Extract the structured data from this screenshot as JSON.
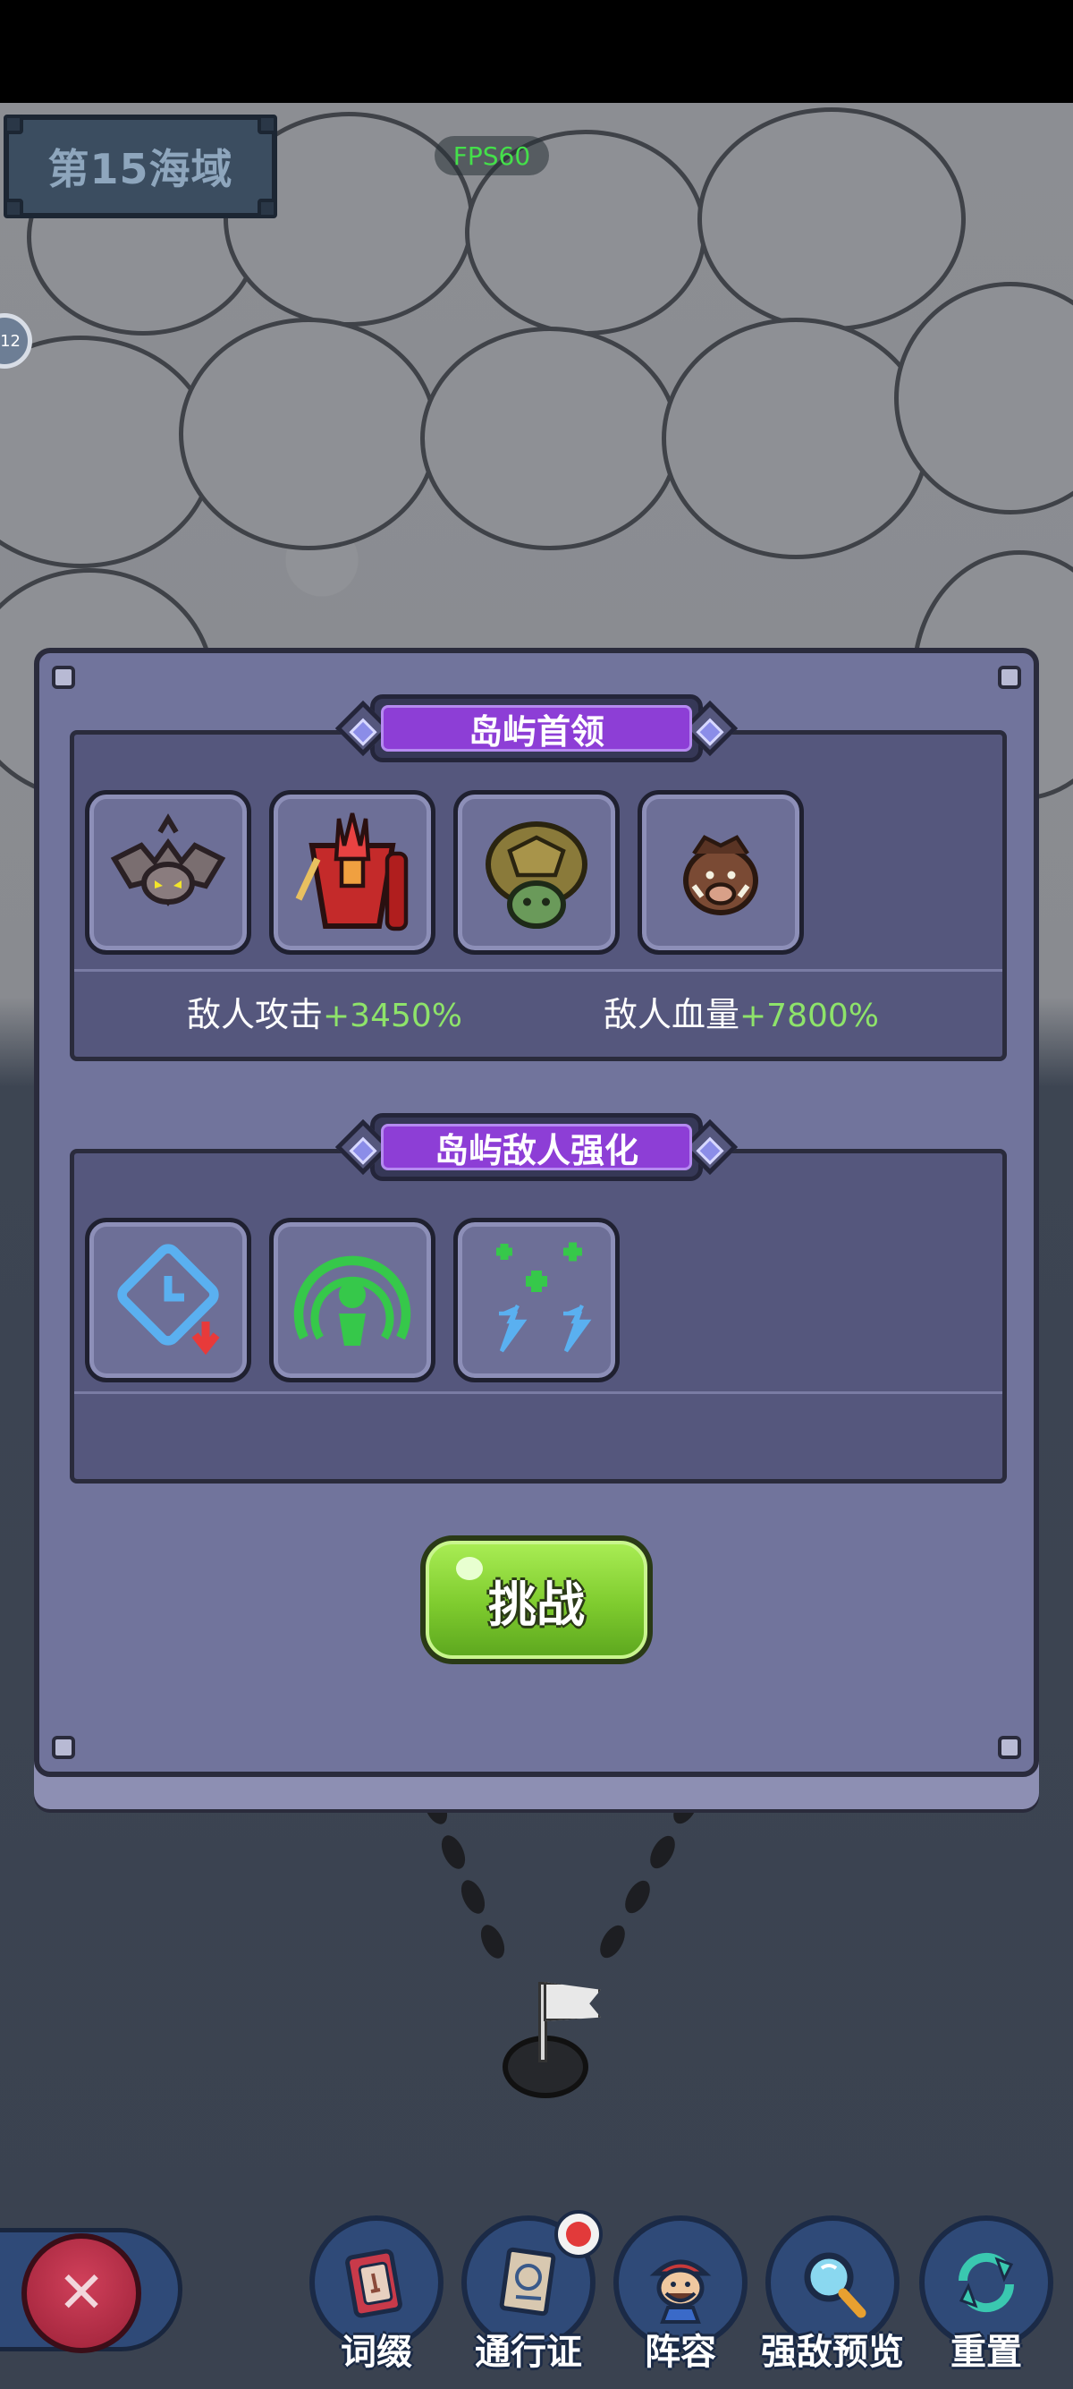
{
  "hud": {
    "sea_zone": "第15海域",
    "fps": "FPS60",
    "side_badge": "12"
  },
  "modal": {
    "boss_section": {
      "title": "岛屿首领",
      "bosses": [
        {
          "icon": "bat-boss-icon"
        },
        {
          "icon": "red-armored-warrior-icon"
        },
        {
          "icon": "turtle-boss-icon"
        },
        {
          "icon": "boar-boss-icon"
        }
      ],
      "attack_label": "敌人攻击",
      "attack_value": "+3450%",
      "hp_label": "敌人血量",
      "hp_value": "+7800%"
    },
    "buff_section": {
      "title": "岛屿敌人强化",
      "buffs": [
        {
          "icon": "clock-cooldown-down-icon"
        },
        {
          "icon": "shield-aura-icon"
        },
        {
          "icon": "energy-boost-plus-icon"
        }
      ]
    },
    "challenge_label": "挑战"
  },
  "bottom_nav": {
    "close_icon": "close-icon",
    "items": [
      {
        "label": "词缀",
        "icon": "affix-card-icon"
      },
      {
        "label": "通行证",
        "icon": "passport-icon"
      },
      {
        "label": "阵容",
        "icon": "lineup-pirate-icon"
      },
      {
        "label": "强敌预览",
        "icon": "magnifier-icon"
      },
      {
        "label": "重置",
        "icon": "reset-arrows-icon"
      }
    ]
  },
  "colors": {
    "modal_bg": "#71749c",
    "section_bg": "#55577d",
    "banner_purple": "#8d3ed6",
    "stat_green": "#8ee36a",
    "challenge_green": "#7ecb2e",
    "close_red": "#b52c45",
    "nav_blue": "#2f4a78"
  }
}
